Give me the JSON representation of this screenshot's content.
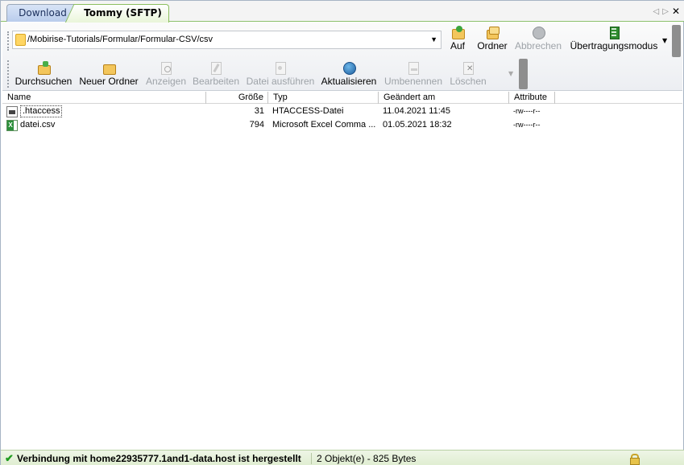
{
  "tabs": [
    {
      "label": "Download",
      "active": false
    },
    {
      "label": "Tommy (SFTP)",
      "active": true
    }
  ],
  "tab_nav": {
    "prev": "◁",
    "next": "▷",
    "close": "✕"
  },
  "address": {
    "path": "/Mobirise-Tutorials/Formular/Formular-CSV/csv",
    "dropdown_glyph": "▼"
  },
  "toolbar_top": [
    {
      "label": "Auf",
      "icon": "folder-up-icon",
      "enabled": true
    },
    {
      "label": "Ordner",
      "icon": "folders-icon",
      "enabled": true
    },
    {
      "label": "Abbrechen",
      "icon": "stop-icon",
      "enabled": false
    },
    {
      "label": "Übertragungsmodus",
      "icon": "transfer-mode-icon",
      "enabled": true
    }
  ],
  "toolbar_bottom": [
    {
      "label": "Durchsuchen",
      "icon": "browse-folder-icon",
      "enabled": true
    },
    {
      "label": "Neuer Ordner",
      "icon": "new-folder-icon",
      "enabled": true
    },
    {
      "label": "Anzeigen",
      "icon": "view-icon",
      "enabled": false
    },
    {
      "label": "Bearbeiten",
      "icon": "edit-icon",
      "enabled": false
    },
    {
      "label": "Datei ausführen",
      "icon": "run-file-icon",
      "enabled": false
    },
    {
      "label": "Aktualisieren",
      "icon": "refresh-icon",
      "enabled": true
    },
    {
      "label": "Umbenennen",
      "icon": "rename-icon",
      "enabled": false
    },
    {
      "label": "Löschen",
      "icon": "delete-icon",
      "enabled": false
    }
  ],
  "columns": {
    "name": "Name",
    "size": "Größe",
    "type": "Typ",
    "modified": "Geändert am",
    "attributes": "Attribute"
  },
  "files": [
    {
      "name": ".htaccess",
      "size": "31",
      "type": "HTACCESS-Datei",
      "modified": "11.04.2021 11:45",
      "attributes": "-rw----r--",
      "icon": "htaccess-file-icon"
    },
    {
      "name": "datei.csv",
      "size": "794",
      "type": "Microsoft Excel Comma ...",
      "modified": "01.05.2021 18:32",
      "attributes": "-rw----r--",
      "icon": "excel-file-icon"
    }
  ],
  "status": {
    "connection": "Verbindung mit home22935777.1and1-data.host ist hergestellt",
    "summary": "2 Objekt(e) - 825 Bytes",
    "check_glyph": "✔"
  },
  "colors": {
    "active_tab_border": "#8bbf5e",
    "status_bg": "#e6f1da",
    "disabled_text": "#9ea3a8"
  }
}
